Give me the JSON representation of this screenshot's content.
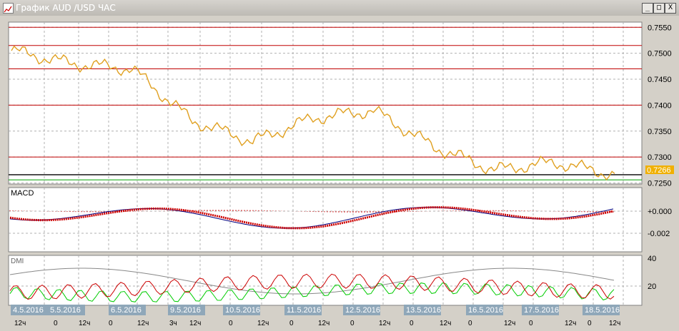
{
  "window": {
    "title": "График AUD /USD  ЧАС",
    "buttons": [
      "_",
      "□",
      "X"
    ]
  },
  "colors": {
    "price": "#e0a020",
    "resistance": "#c00000",
    "support": "#000000",
    "green_line": "#00a000",
    "macd_main": "#000080",
    "macd_signal": "#cc0000",
    "dmi_adx": "#888888",
    "dmi_plus": "#00cc00",
    "dmi_minus": "#cc0000",
    "date_badge": "#8fa7b9",
    "price_badge": "#f0b000"
  },
  "price_axis": {
    "labels": [
      "0.7550",
      "0.7500",
      "0.7450",
      "0.7400",
      "0.7350",
      "0.7300",
      "0.7250"
    ],
    "current": "0.7266"
  },
  "macd": {
    "title": "MACD",
    "labels": [
      "+0.000",
      "-0.002"
    ]
  },
  "dmi": {
    "title": "DMI",
    "labels": [
      "40",
      "20"
    ]
  },
  "date_labels": [
    "4.5.2016",
    "5.5.2016",
    "6.5.2016",
    "9.5.2016",
    "10.5.2016",
    "11.5.2016",
    "12.5.2016",
    "13.5.2016",
    "16.5.2016",
    "17.5.2016",
    "18.5.2016"
  ],
  "time_labels": [
    "12ч",
    "0",
    "12ч",
    "0",
    "12ч",
    "3ч",
    "12ч",
    "0",
    "12ч",
    "0",
    "12ч",
    "0",
    "12ч",
    "0",
    "12ч",
    "0",
    "12ч",
    "0",
    "12ч",
    "0",
    "12ч"
  ],
  "chart_data": {
    "type": "line",
    "title": "График AUD /USD  ЧАС",
    "x": [
      "4.5.2016",
      "5.5.2016",
      "6.5.2016",
      "9.5.2016",
      "10.5.2016",
      "11.5.2016",
      "12.5.2016",
      "13.5.2016",
      "16.5.2016",
      "17.5.2016",
      "18.5.2016"
    ],
    "series": [
      {
        "values": [
          0.7505,
          0.748,
          0.747,
          0.737,
          0.733,
          0.7375,
          0.739,
          0.732,
          0.7275,
          0.729,
          0.7266
        ]
      }
    ],
    "horizontal_lines": [
      0.755,
      0.7515,
      0.747,
      0.74,
      0.73,
      0.7266
    ],
    "ylim": [
      0.725,
      0.756
    ]
  }
}
